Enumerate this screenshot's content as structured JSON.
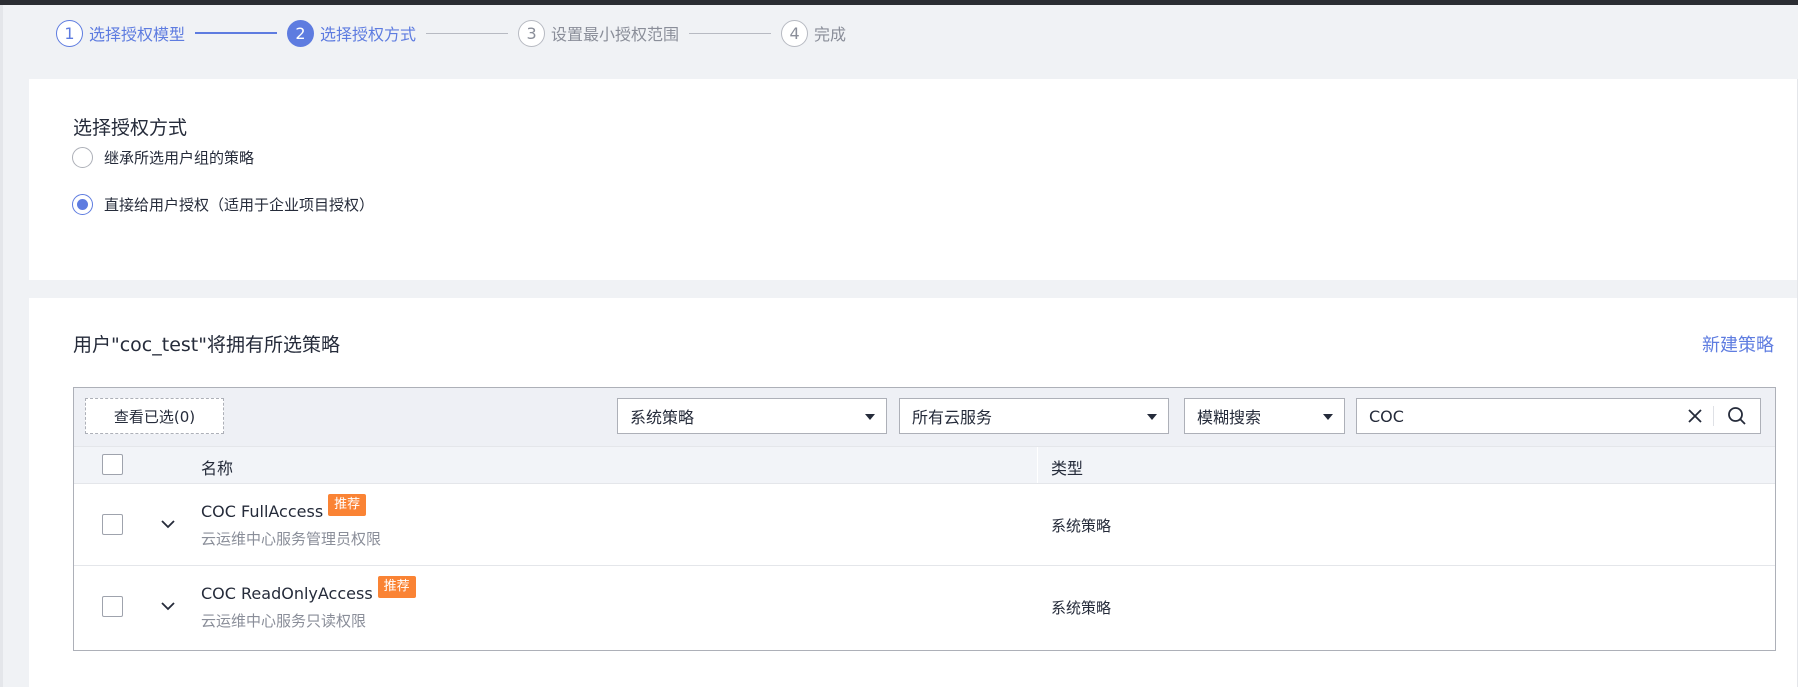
{
  "stepper": {
    "steps": [
      {
        "num": "1",
        "label": "选择授权模型"
      },
      {
        "num": "2",
        "label": "选择授权方式"
      },
      {
        "num": "3",
        "label": "设置最小授权范围"
      },
      {
        "num": "4",
        "label": "完成"
      }
    ]
  },
  "method_card": {
    "title": "选择授权方式",
    "options": [
      {
        "label": "继承所选用户组的策略",
        "checked": false
      },
      {
        "label": "直接给用户授权（适用于企业项目授权）",
        "checked": true
      }
    ]
  },
  "policy_card": {
    "title": "用户\"coc_test\"将拥有所选策略",
    "new_policy_link": "新建策略",
    "toolbar": {
      "view_selected": "查看已选(0)",
      "policy_type_select": "系统策略",
      "service_select": "所有云服务",
      "search_mode_select": "模糊搜索",
      "search_value": "COC"
    },
    "table": {
      "headers": {
        "name": "名称",
        "type": "类型"
      },
      "rows": [
        {
          "name": "COC FullAccess",
          "tag": "推荐",
          "desc": "云运维中心服务管理员权限",
          "type": "系统策略"
        },
        {
          "name": "COC ReadOnlyAccess",
          "tag": "推荐",
          "desc": "云运维中心服务只读权限",
          "type": "系统策略"
        }
      ]
    }
  },
  "colors": {
    "primary": "#5e7ce0",
    "tag": "#fa8334",
    "text": "#252b3a",
    "muted": "#8a8e99"
  },
  "icons": [
    "clear-icon",
    "search-icon",
    "chevron-down-icon",
    "caret-down-icon"
  ]
}
